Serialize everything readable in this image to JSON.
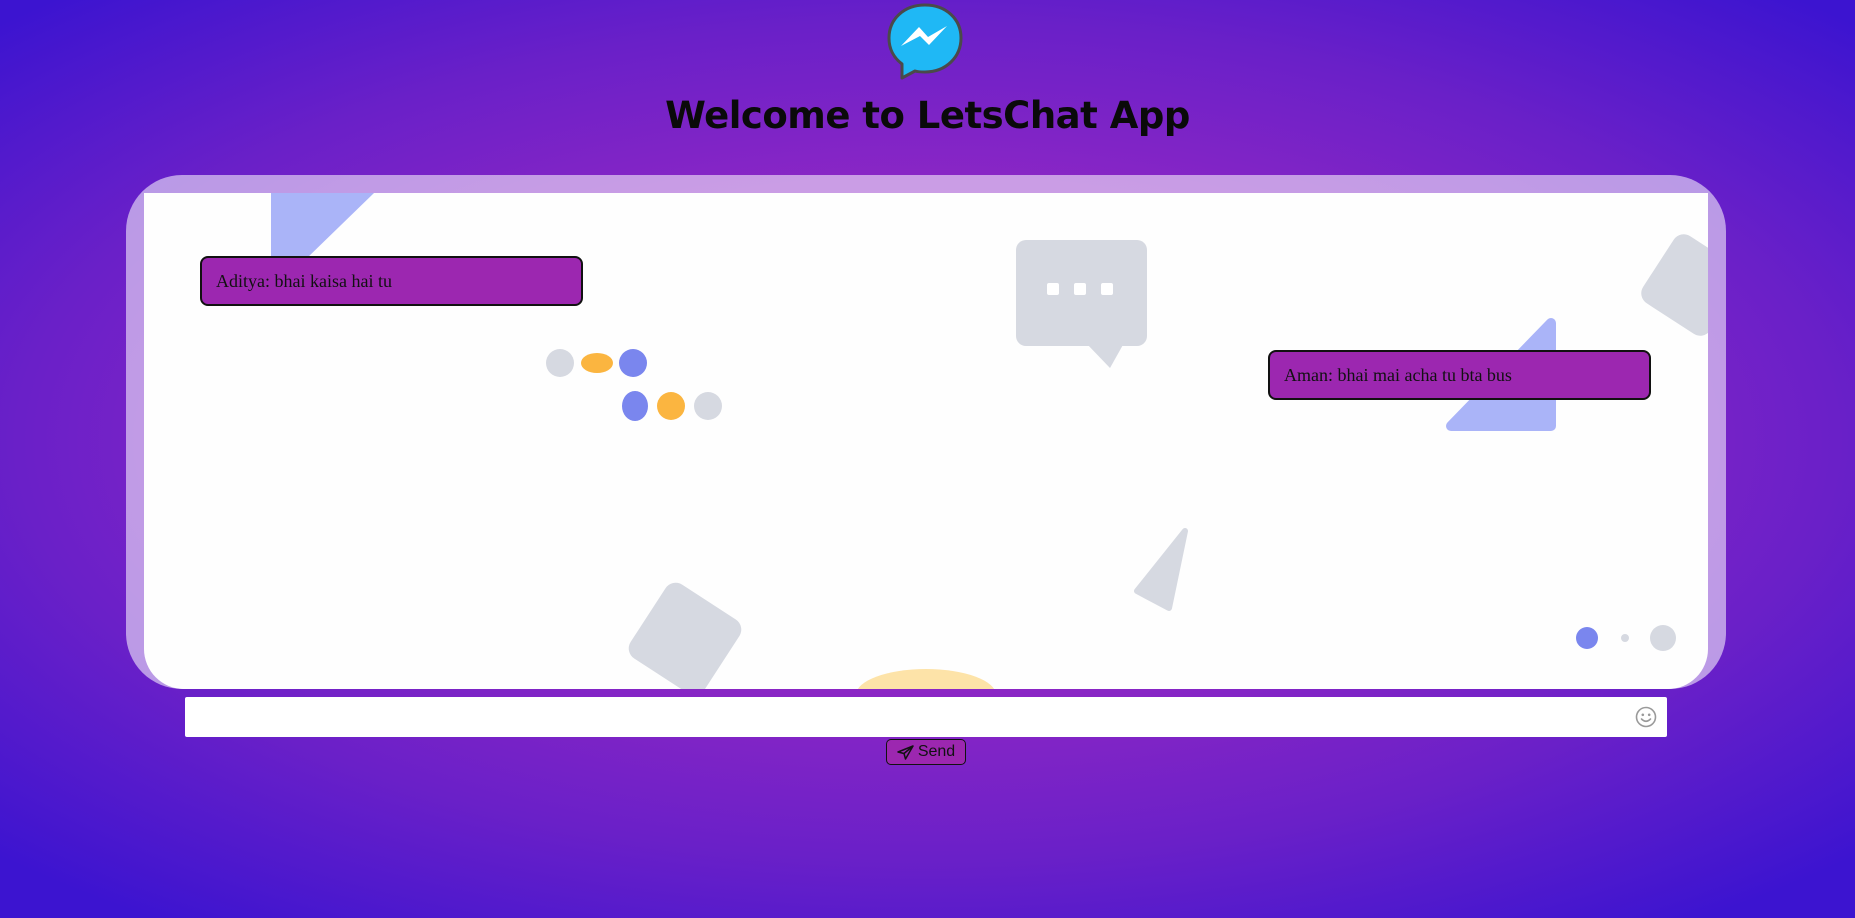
{
  "app": {
    "title": "Welcome to LetsChat App",
    "logo_icon": "messenger-logo-icon"
  },
  "messages": [
    {
      "sender": "Aditya",
      "text": "Aditya: bhai kaisa hai tu",
      "side": "left"
    },
    {
      "sender": "Aman",
      "text": "Aman: bhai mai acha tu bta bus",
      "side": "right"
    }
  ],
  "composer": {
    "value": "",
    "placeholder": "",
    "emoji_icon": "smiley-icon",
    "send_label": "Send",
    "send_icon": "paper-plane-icon"
  },
  "colors": {
    "bubble": "#9c27b0",
    "background_center": "#a52cc4",
    "background_edge": "#3c14d0",
    "logo_blue": "#00b2ff"
  }
}
